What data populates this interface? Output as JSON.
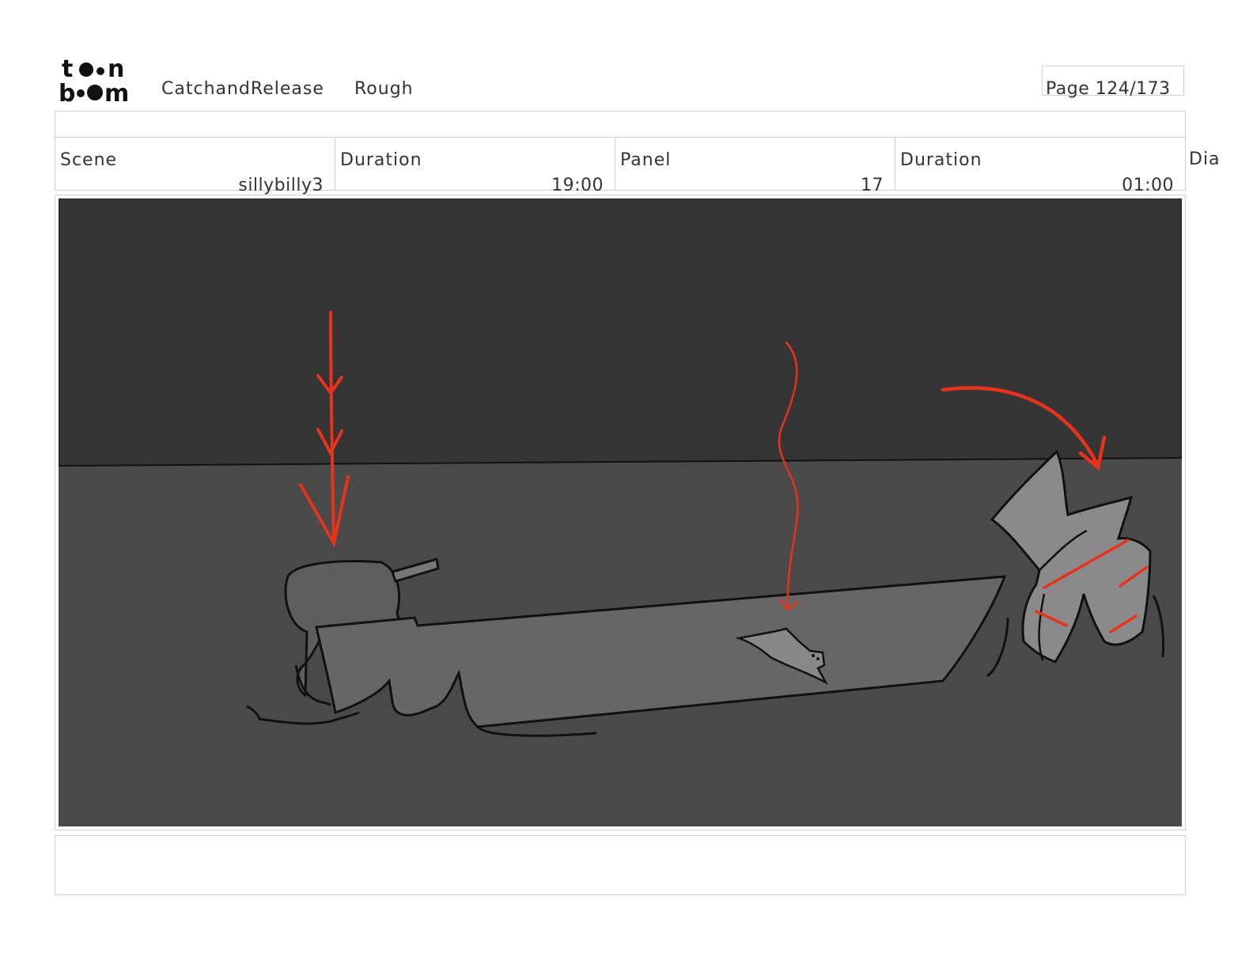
{
  "header": {
    "logo": "toon boom",
    "project": "CatchandRelease",
    "stage": "Rough",
    "page": "Page 124/173"
  },
  "info": {
    "scene_label": "Scene",
    "scene_value": "sillybilly3",
    "scene_duration_label": "Duration",
    "scene_duration_value": "19:00",
    "panel_label": "Panel",
    "panel_value": "17",
    "panel_duration_label": "Duration",
    "panel_duration_value": "01:00",
    "dialogue_label": "Dia"
  },
  "colors": {
    "sky": "#353535",
    "water": "#4a4a4a",
    "boat": "#666666",
    "annotation_red": "#e8321c"
  }
}
